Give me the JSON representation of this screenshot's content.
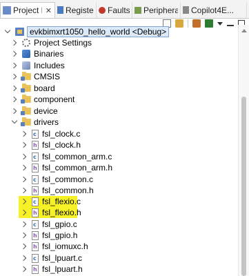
{
  "tabs": [
    {
      "label": "Project Ex...",
      "icon": "project-explorer-icon",
      "active": true
    },
    {
      "label": "Registers",
      "icon": "registers-icon"
    },
    {
      "label": "Faults",
      "icon": "faults-icon"
    },
    {
      "label": "Periphera...",
      "icon": "peripherals-icon"
    },
    {
      "label": "Copilot4E...",
      "icon": "copilot-icon"
    }
  ],
  "close_glyph": "✕",
  "toolbar": [
    "collapse-all-icon",
    "link-with-editor-icon",
    "filter-icon",
    "view-menu-icon",
    "minimize-icon",
    "maximize-icon"
  ],
  "tree": {
    "project": "evkbimxrt1050_hello_world <Debug>",
    "top_items": [
      {
        "label": "Project Settings",
        "icon": "settings-icon"
      },
      {
        "label": "Binaries",
        "icon": "binaries-icon"
      },
      {
        "label": "Includes",
        "icon": "includes-icon"
      },
      {
        "label": "CMSIS",
        "icon": "folder-icon"
      },
      {
        "label": "board",
        "icon": "folder-icon"
      },
      {
        "label": "component",
        "icon": "folder-icon"
      },
      {
        "label": "device",
        "icon": "folder-icon"
      },
      {
        "label": "drivers",
        "icon": "folder-icon",
        "expanded": true
      }
    ],
    "driver_files": [
      "fsl_clock.c",
      "fsl_clock.h",
      "fsl_common_arm.c",
      "fsl_common_arm.h",
      "fsl_common.c",
      "fsl_common.h",
      "fsl_flexio.c",
      "fsl_flexio.h",
      "fsl_gpio.c",
      "fsl_gpio.h",
      "fsl_iomuxc.h",
      "fsl_lpuart.c",
      "fsl_lpuart.h"
    ],
    "highlighted": [
      "fsl_flexio.c",
      "fsl_flexio.h"
    ]
  },
  "colors": {
    "highlight": "#f7f227",
    "selection_bg": "#dbe9f8",
    "folder": "#e8c25a"
  }
}
